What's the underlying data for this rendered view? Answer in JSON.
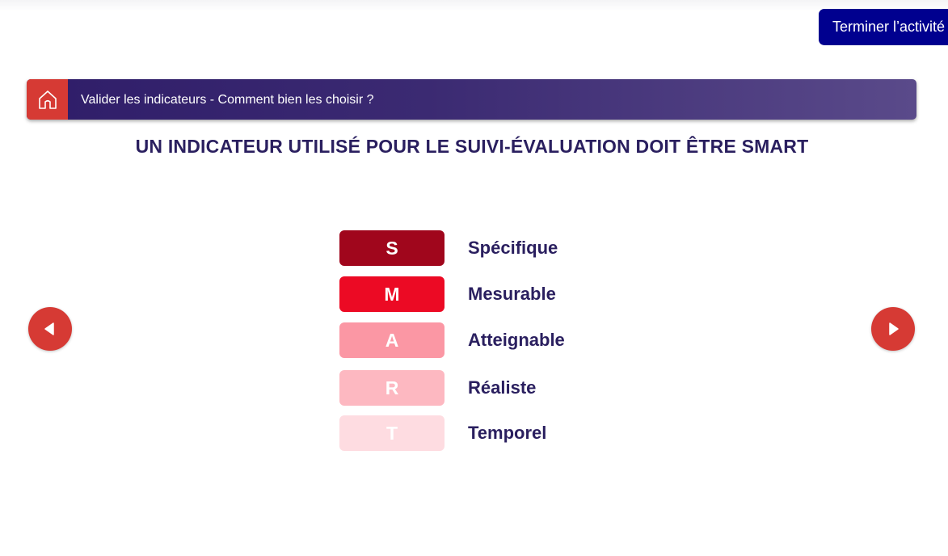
{
  "toolbar": {
    "finish_label": "Terminer l’activité"
  },
  "header": {
    "home_icon": "home-icon",
    "title": "Valider les indicateurs - Comment bien les choisir ?"
  },
  "main": {
    "title": "UN INDICATEUR UTILISÉ POUR LE SUIVI-ÉVALUATION DOIT ÊTRE SMART",
    "items": [
      {
        "letter": "S",
        "word": "Spécifique",
        "color": "#a0061c"
      },
      {
        "letter": "M",
        "word": "Mesurable",
        "color": "#ec0a24"
      },
      {
        "letter": "A",
        "word": "Atteignable",
        "color": "#fb97a4"
      },
      {
        "letter": "R",
        "word": "Réaliste",
        "color": "#fdb8c1"
      },
      {
        "letter": "T",
        "word": "Temporel",
        "color": "#fedce1"
      }
    ]
  },
  "navigation": {
    "prev_icon": "triangle-left-icon",
    "next_icon": "triangle-right-icon",
    "accent_color": "#d63a34"
  },
  "colors": {
    "header_start": "#2f1d69",
    "header_end": "#5a4a8a",
    "finish_button": "#00008f",
    "title_text": "#2a1f5f"
  }
}
